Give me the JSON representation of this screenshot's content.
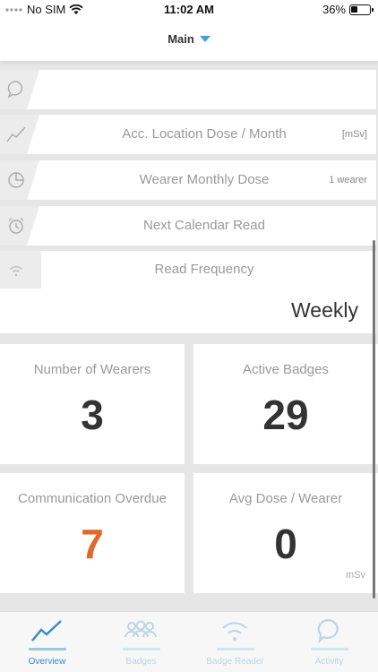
{
  "status_bar": {
    "carrier": "No SIM",
    "time": "11:02 AM",
    "battery_pct": "36%",
    "battery_level": 0.36
  },
  "header": {
    "title": "Main"
  },
  "rows": [
    {
      "label": "",
      "unit": "",
      "icon": "speech-bubble-icon"
    },
    {
      "label": "Acc. Location Dose / Month",
      "unit": "[mSv]",
      "icon": "line-chart-icon"
    },
    {
      "label": "Wearer Monthly Dose",
      "unit": "1 wearer",
      "icon": "pie-chart-icon"
    },
    {
      "label": "Next Calendar Read",
      "unit": "",
      "icon": "alarm-clock-icon"
    }
  ],
  "read_frequency": {
    "label": "Read Frequency",
    "value": "Weekly",
    "icon": "wifi-icon"
  },
  "tiles": [
    {
      "label": "Number of Wearers",
      "value": "3",
      "unit": "",
      "color": "#333333"
    },
    {
      "label": "Active Badges",
      "value": "29",
      "unit": "",
      "color": "#333333"
    },
    {
      "label": "Communication Overdue",
      "value": "7",
      "unit": "",
      "color": "#e0692a"
    },
    {
      "label": "Avg Dose / Wearer",
      "value": "0",
      "unit": "mSv",
      "color": "#333333"
    }
  ],
  "tabs": [
    {
      "label": "Overview",
      "icon": "trend-line-icon",
      "active": true
    },
    {
      "label": "Badges",
      "icon": "people-icon",
      "active": false
    },
    {
      "label": "Badge Reader",
      "icon": "wifi-signal-icon",
      "active": false
    },
    {
      "label": "Activity",
      "icon": "chat-bubble-icon",
      "active": false
    }
  ],
  "colors": {
    "accent": "#2f8fc4",
    "caret": "#3aa3d9",
    "overdue": "#e0692a"
  }
}
